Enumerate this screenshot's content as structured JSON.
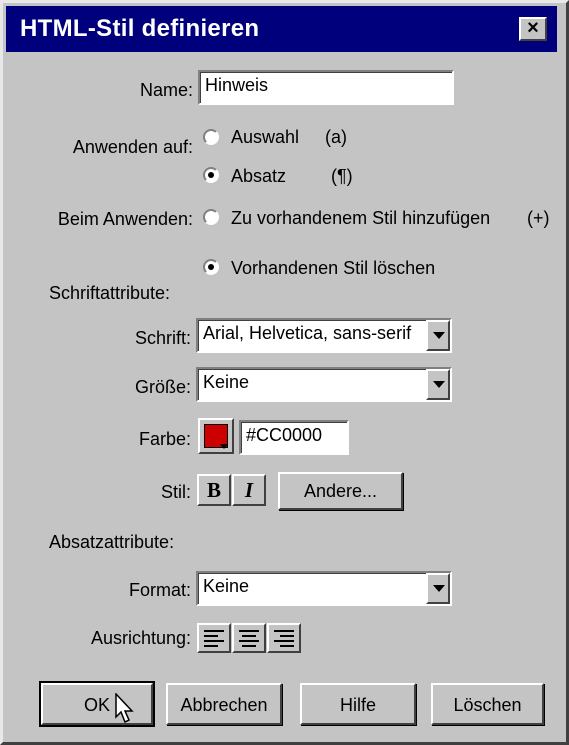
{
  "dialog": {
    "title": "HTML-Stil definieren",
    "close_glyph": "×"
  },
  "name": {
    "label": "Name:",
    "value": "Hinweis"
  },
  "apply_to": {
    "label": "Anwenden auf:",
    "options": [
      {
        "label": "Auswahl",
        "shortcut": "(a)",
        "selected": false
      },
      {
        "label": "Absatz",
        "shortcut": "(¶)",
        "selected": true
      }
    ]
  },
  "on_apply": {
    "label": "Beim Anwenden:",
    "options": [
      {
        "label": "Zu vorhandenem Stil hinzufügen",
        "shortcut": "(+)",
        "selected": false
      },
      {
        "label": "Vorhandenen Stil löschen",
        "selected": true
      }
    ]
  },
  "font_attrs": {
    "section": "Schriftattribute:",
    "font_label": "Schrift:",
    "font_value": "Arial, Helvetica, sans-serif",
    "size_label": "Größe:",
    "size_value": "Keine",
    "color_label": "Farbe:",
    "color_value": "#CC0000",
    "style_label": "Stil:",
    "bold_glyph": "B",
    "italic_glyph": "I",
    "other_button": "Andere..."
  },
  "para_attrs": {
    "section": "Absatzattribute:",
    "format_label": "Format:",
    "format_value": "Keine",
    "align_label": "Ausrichtung:",
    "align_options": [
      "left-align-icon",
      "center-align-icon",
      "right-align-icon"
    ]
  },
  "buttons": {
    "ok": "OK",
    "cancel": "Abbrechen",
    "help": "Hilfe",
    "delete": "Löschen"
  },
  "colors": {
    "titlebar": "#00007C",
    "swatch": "#CC0000",
    "face": "#C4C4C4"
  }
}
